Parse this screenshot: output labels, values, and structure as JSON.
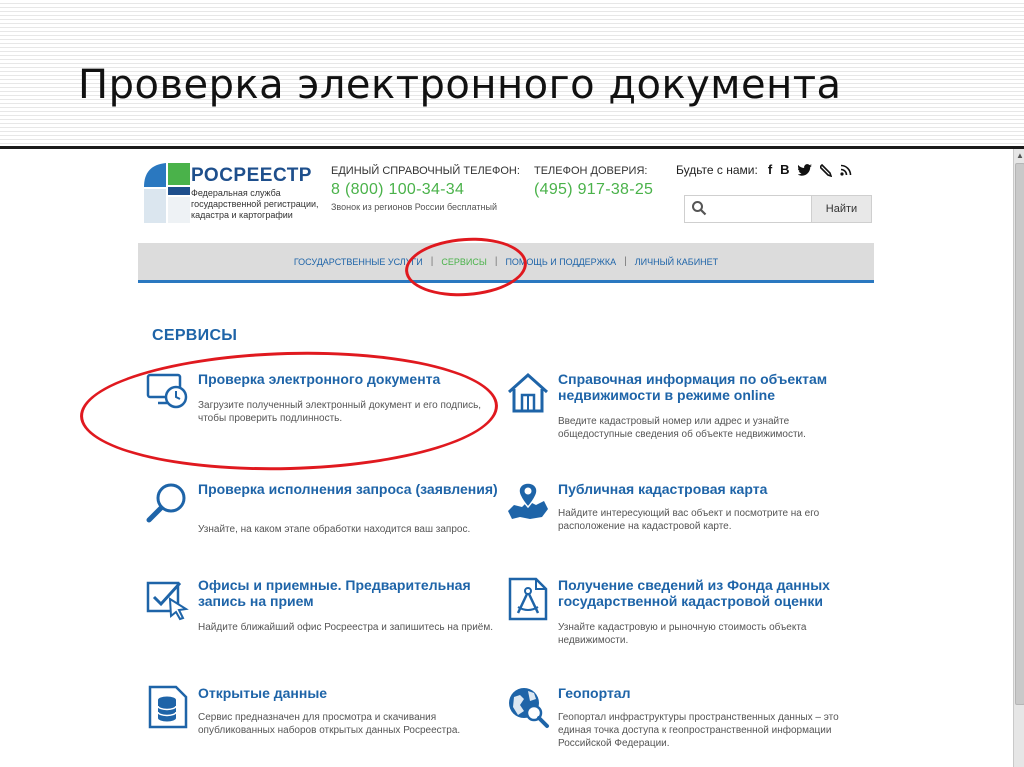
{
  "slide": {
    "title": "Проверка электронного документа"
  },
  "site": {
    "logo": {
      "name": "РОСРЕЕСТР",
      "description": "Федеральная служба государственной регистрации, кадастра и картографии"
    },
    "contacts": [
      {
        "label": "ЕДИНЫЙ СПРАВОЧНЫЙ ТЕЛЕФОН:",
        "phone": "8 (800) 100-34-34",
        "note": "Звонок из регионов России бесплатный"
      },
      {
        "label": "ТЕЛЕФОН ДОВЕРИЯ:",
        "phone": "(495) 917-38-25",
        "note": ""
      }
    ],
    "social": {
      "label": "Будьте с нами:"
    },
    "search": {
      "value": "",
      "placeholder": "",
      "button": "Найти"
    },
    "nav": [
      {
        "label": "ГОСУДАРСТВЕННЫЕ УСЛУГИ"
      },
      {
        "label": "СЕРВИСЫ"
      },
      {
        "label": "ПОМОЩЬ И ПОДДЕРЖКА"
      },
      {
        "label": "ЛИЧНЫЙ КАБИНЕТ"
      }
    ],
    "section_title": "СЕРВИСЫ",
    "services": [
      {
        "title": "Проверка электронного документа",
        "desc": "Загрузите полученный электронный документ и его подпись, чтобы проверить подлинность.",
        "icon": "monitor-clock-icon"
      },
      {
        "title": "Справочная информация по объектам недвижимости в режиме online",
        "desc": "Введите кадастровый номер или адрес и узнайте общедоступные сведения об объекте недвижимости.",
        "icon": "house-icon"
      },
      {
        "title": "Проверка исполнения запроса (заявления)",
        "desc": "Узнайте, на каком этапе обработки находится ваш запрос.",
        "icon": "magnifier-icon"
      },
      {
        "title": "Публичная кадастровая карта",
        "desc": "Найдите интересующий вас объект и посмотрите на его расположение на кадастровой карте.",
        "icon": "map-pin-icon"
      },
      {
        "title": "Офисы и приемные. Предварительная запись на прием",
        "desc": "Найдите ближайший офис Росреестра и запишитесь на приём.",
        "icon": "checkbox-cursor-icon"
      },
      {
        "title": "Получение сведений из Фонда данных государственной кадастровой оценки",
        "desc": "Узнайте кадастровую и рыночную стоимость объекта недвижимости.",
        "icon": "compass-document-icon"
      },
      {
        "title": "Открытые данные",
        "desc": "Сервис предназначен для просмотра и скачивания опубликованных наборов открытых данных Росреестра.",
        "icon": "database-icon"
      },
      {
        "title": "Геопортал",
        "desc": "Геопортал инфраструктуры пространственных данных – это единая точка доступа к геопространственной информации Российской Федерации.",
        "icon": "globe-search-icon"
      }
    ]
  },
  "colors": {
    "brand_blue": "#1e64a8",
    "brand_green": "#4ab24a",
    "highlight_red": "#e0191f"
  }
}
